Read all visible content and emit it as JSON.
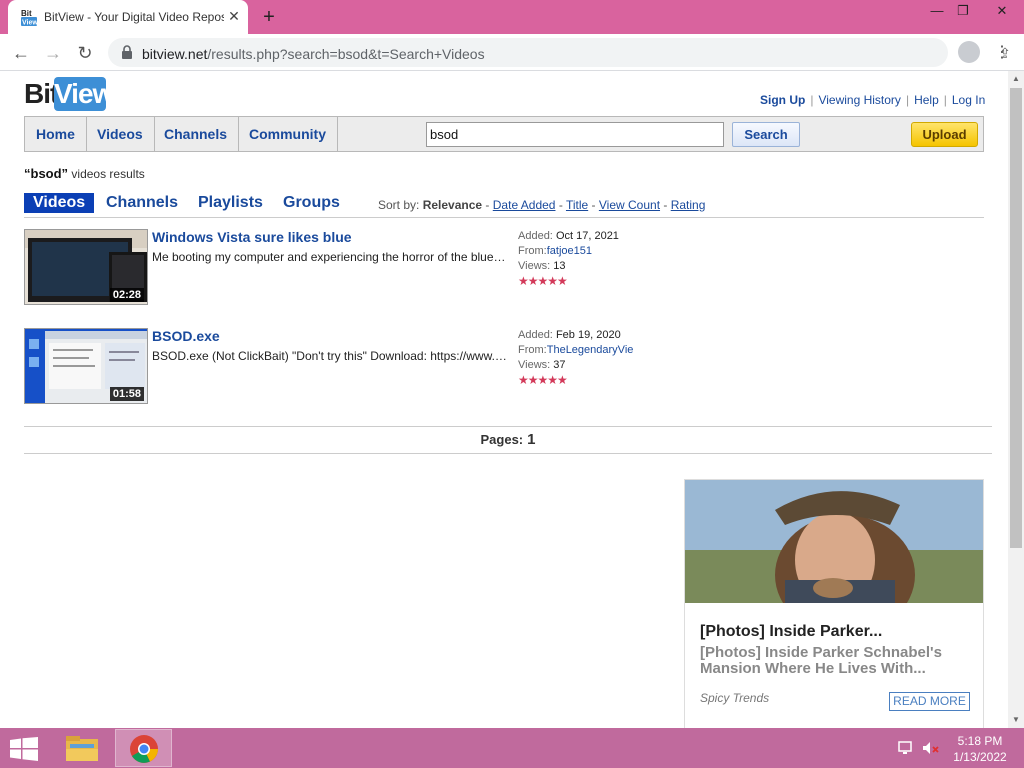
{
  "browser": {
    "tab_title": "BitView - Your Digital Video Repository",
    "new_tab_label": "+",
    "url_host": "bitview.net",
    "url_path": "/results.php?search=bsod&t=Search+Videos"
  },
  "site": {
    "logo_bit": "Bit",
    "logo_view": "View",
    "top_links": {
      "signup": "Sign Up",
      "history": "Viewing History",
      "help": "Help",
      "login": "Log In"
    },
    "nav": [
      "Home",
      "Videos",
      "Channels",
      "Community"
    ],
    "search_value": "bsod",
    "search_button": "Search",
    "upload_button": "Upload"
  },
  "results": {
    "query": "“bsod”",
    "suffix": "videos results",
    "tabs": [
      "Videos",
      "Channels",
      "Playlists",
      "Groups"
    ],
    "sort_label": "Sort by:",
    "sort_current": "Relevance",
    "sort_options": [
      "Date Added",
      "Title",
      "View Count",
      "Rating"
    ],
    "items": [
      {
        "title": "Windows Vista sure likes blue",
        "description": "Me booting my computer and experiencing the horror of the blue screen of death",
        "duration": "02:28",
        "added_label": "Added:",
        "added": "Oct 17, 2021",
        "from_label": "From:",
        "from": "fatjoe151",
        "views_label": "Views:",
        "views": "13",
        "stars": "★★★★★"
      },
      {
        "title": "BSOD.exe",
        "description": "BSOD.exe (Not ClickBait) \"Don't try this\" Download: https://www.mediafire.com",
        "duration": "01:58",
        "added_label": "Added:",
        "added": "Feb 19, 2020",
        "from_label": "From:",
        "from": "TheLegendaryVie",
        "views_label": "Views:",
        "views": "37",
        "stars": "★★★★★"
      }
    ],
    "pages_label": "Pages:",
    "page_number": "1"
  },
  "ad": {
    "headline": "[Photos] Inside Parker...",
    "subheadline": "[Photos] Inside Parker Schnabel's Mansion Where He Lives With...",
    "source": "Spicy Trends",
    "button": "READ MORE"
  },
  "taskbar": {
    "time": "5:18 PM",
    "date": "1/13/2022"
  },
  "colors": {
    "titlebar": "#d9639e",
    "taskbar": "#c06a9d",
    "link": "#1a4a9c",
    "active_tab": "#0b3fb5",
    "upload": "#f5c400",
    "stars": "#d33a5a"
  }
}
